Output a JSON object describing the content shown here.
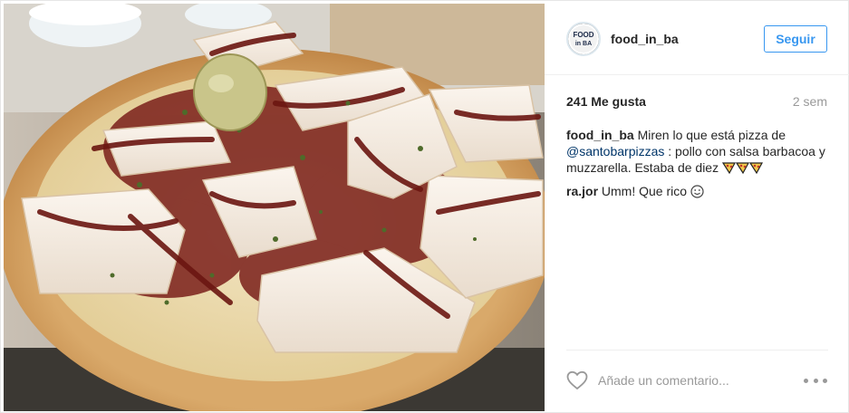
{
  "post": {
    "username": "food_in_ba",
    "follow_label": "Seguir",
    "likes": "241 Me gusta",
    "time_ago": "2 sem",
    "caption": {
      "author": "food_in_ba",
      "text_before": "Miren lo que está pizza de",
      "mention": "@santobarpizzas",
      "text_after": ": pollo con salsa barbacoa y muzzarella. Estaba de diez"
    },
    "comments": [
      {
        "author": "ra.jor",
        "text": "Umm! Que rico"
      }
    ],
    "add_comment_placeholder": "Añade un comentario...",
    "avatar_text": "FOOD in BA"
  },
  "icons": {
    "heart": "heart-outline-icon",
    "more": "more-options-icon",
    "pizza": "pizza-slice-icon",
    "smile": "smiley-face-icon"
  },
  "colors": {
    "accent_blue": "#3897f0",
    "mention_blue": "#003569",
    "muted_gray": "#999999",
    "divider": "#efefef"
  }
}
